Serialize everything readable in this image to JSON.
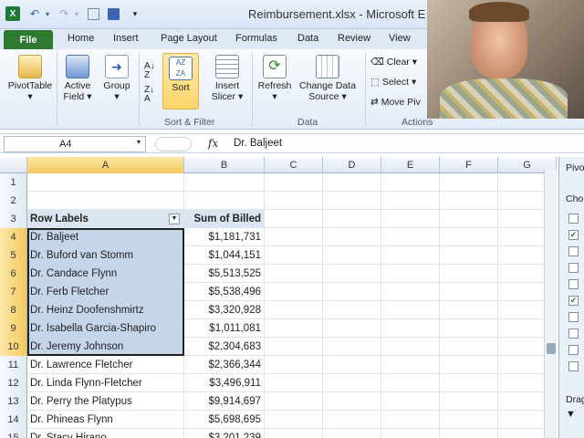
{
  "window": {
    "title": "Reimbursement.xlsx - Microsoft E"
  },
  "tabs": [
    {
      "label": "File"
    },
    {
      "label": "Home"
    },
    {
      "label": "Insert"
    },
    {
      "label": "Page Layout"
    },
    {
      "label": "Formulas"
    },
    {
      "label": "Data"
    },
    {
      "label": "Review"
    },
    {
      "label": "View"
    }
  ],
  "ribbon": {
    "pivottable": "PivotTable",
    "active_field": [
      "Active",
      "Field"
    ],
    "group": "Group",
    "sort": "Sort",
    "insert_slicer": [
      "Insert",
      "Slicer"
    ],
    "refresh": "Refresh",
    "change_data_source": [
      "Change Data",
      "Source"
    ],
    "clear": "Clear",
    "select": "Select",
    "move_pivot": "Move Piv",
    "group_labels": {
      "sort_filter": "Sort & Filter",
      "data": "Data",
      "actions": "Actions"
    }
  },
  "formula_bar": {
    "cell_ref": "A4",
    "fx": "fx",
    "value": "Dr. Baljeet"
  },
  "columns": [
    "A",
    "B",
    "C",
    "D",
    "E",
    "F",
    "G"
  ],
  "rows": [
    {
      "num": "1",
      "a": "",
      "b": ""
    },
    {
      "num": "2",
      "a": "",
      "b": ""
    },
    {
      "num": "3",
      "a": "Row Labels",
      "b": "Sum of Billed"
    },
    {
      "num": "4",
      "a": "Dr. Baljeet",
      "b": "$1,181,731"
    },
    {
      "num": "5",
      "a": "Dr. Buford van Stomm",
      "b": "$1,044,151"
    },
    {
      "num": "6",
      "a": "Dr. Candace Flynn",
      "b": "$5,513,525"
    },
    {
      "num": "7",
      "a": "Dr. Ferb Fletcher",
      "b": "$5,538,496"
    },
    {
      "num": "8",
      "a": "Dr. Heinz Doofenshmirtz",
      "b": "$3,320,928"
    },
    {
      "num": "9",
      "a": "Dr. Isabella Garcia-Shapiro",
      "b": "$1,011,081"
    },
    {
      "num": "10",
      "a": "Dr. Jeremy Johnson",
      "b": "$2,304,683"
    },
    {
      "num": "11",
      "a": "Dr. Lawrence Fletcher",
      "b": "$2,366,344"
    },
    {
      "num": "12",
      "a": "Dr. Linda Flynn-Fletcher",
      "b": "$3,496,911"
    },
    {
      "num": "13",
      "a": "Dr. Perry the Platypus",
      "b": "$9,914,697"
    },
    {
      "num": "14",
      "a": "Dr. Phineas Flynn",
      "b": "$5,698,695"
    },
    {
      "num": "15",
      "a": "Dr. Stacy Hirano",
      "b": "$3,201,239"
    }
  ],
  "pivot_pane": {
    "title": "Pivo",
    "choose": "Cho",
    "drag": "Drag"
  },
  "colors": {
    "file_tab": "#2f7a33",
    "selection": "#c5d5ea",
    "header_highlight": "#f3c95b"
  }
}
